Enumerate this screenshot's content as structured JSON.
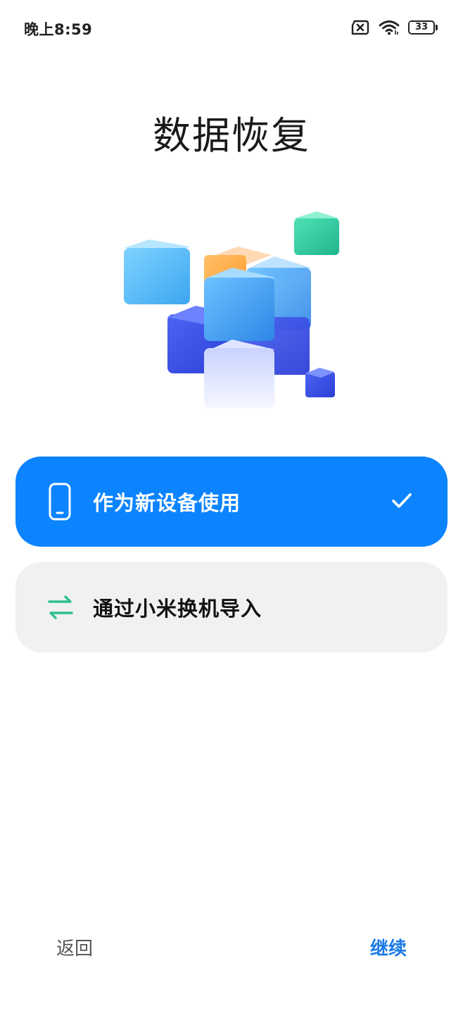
{
  "status_bar": {
    "time": "晚上8:59",
    "battery_level": "33",
    "battery_fraction": 0.33,
    "icons": [
      "sim-off-icon",
      "wifi-icon",
      "battery-icon"
    ]
  },
  "page": {
    "title": "数据恢复"
  },
  "options": [
    {
      "label": "作为新设备使用",
      "icon": "phone-icon",
      "selected": true
    },
    {
      "label": "通过小米换机导入",
      "icon": "transfer-arrows-icon",
      "selected": false
    }
  ],
  "navigation": {
    "back_label": "返回",
    "continue_label": "继续"
  },
  "colors": {
    "accent": "#0d84ff",
    "continue_text": "#1a7ae6",
    "transfer_icon": "#2fbf8a",
    "card_bg": "#f1f1f1"
  }
}
